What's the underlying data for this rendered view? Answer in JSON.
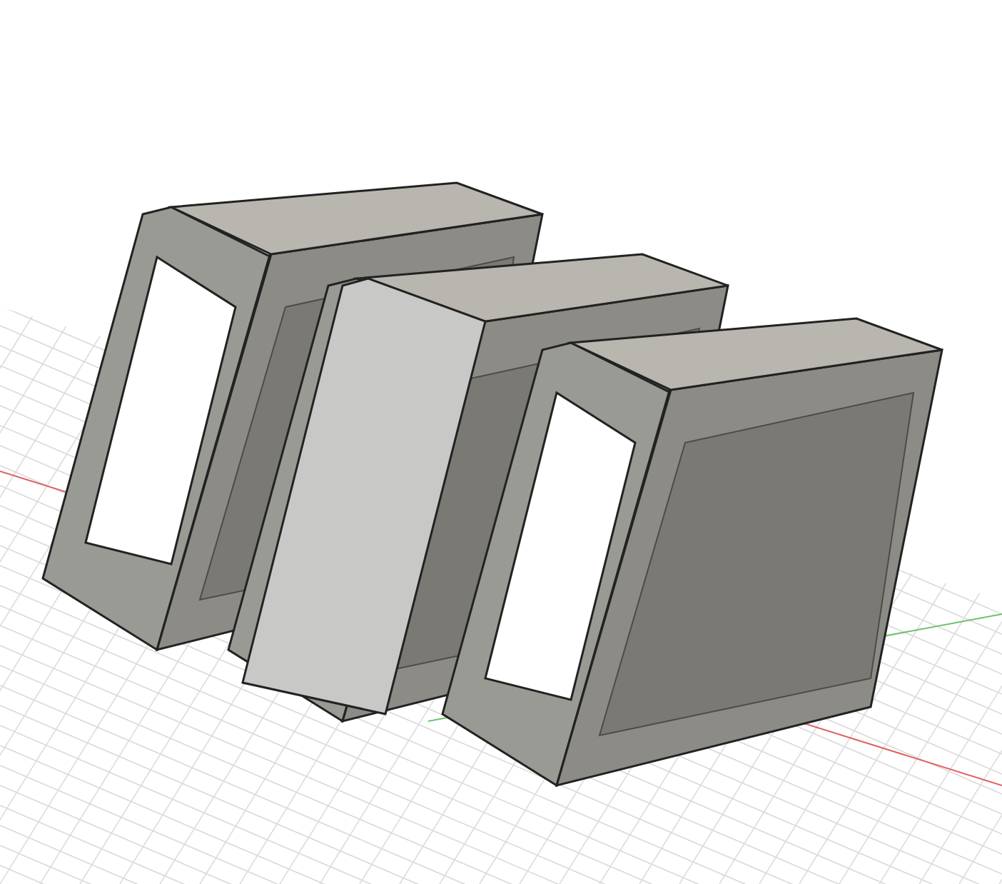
{
  "viewport": {
    "axes": [
      {
        "color": "#e06060"
      },
      {
        "color": "#70c070"
      }
    ]
  }
}
